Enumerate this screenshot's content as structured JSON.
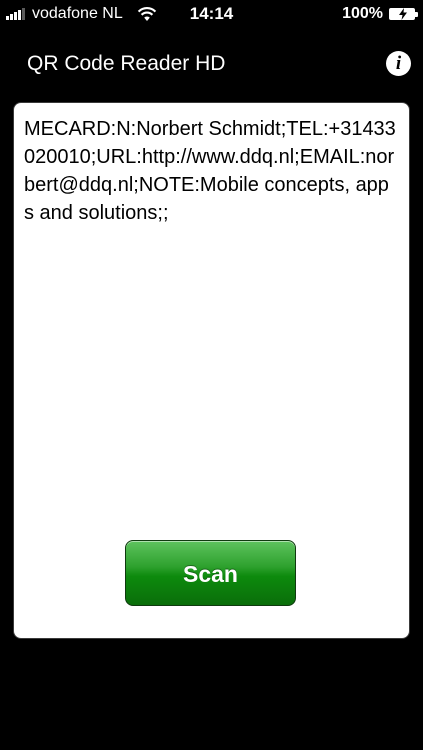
{
  "status_bar": {
    "carrier": "vodafone NL",
    "time": "14:14",
    "battery_percent": "100%",
    "signal_icon": "signal-bars-icon",
    "wifi_icon": "wifi-icon",
    "battery_icon": "battery-charging-icon"
  },
  "nav": {
    "title": "QR Code Reader HD",
    "info_label": "i"
  },
  "result": {
    "text": "MECARD:N:Norbert Schmidt;TEL:+31433020010;URL:http://www.ddq.nl;EMAIL:norbert@ddq.nl;NOTE:Mobile concepts, apps and solutions;;"
  },
  "actions": {
    "scan_label": "Scan"
  },
  "colors": {
    "background": "#000000",
    "card": "#ffffff",
    "scan_button": "#0d8a0d"
  }
}
